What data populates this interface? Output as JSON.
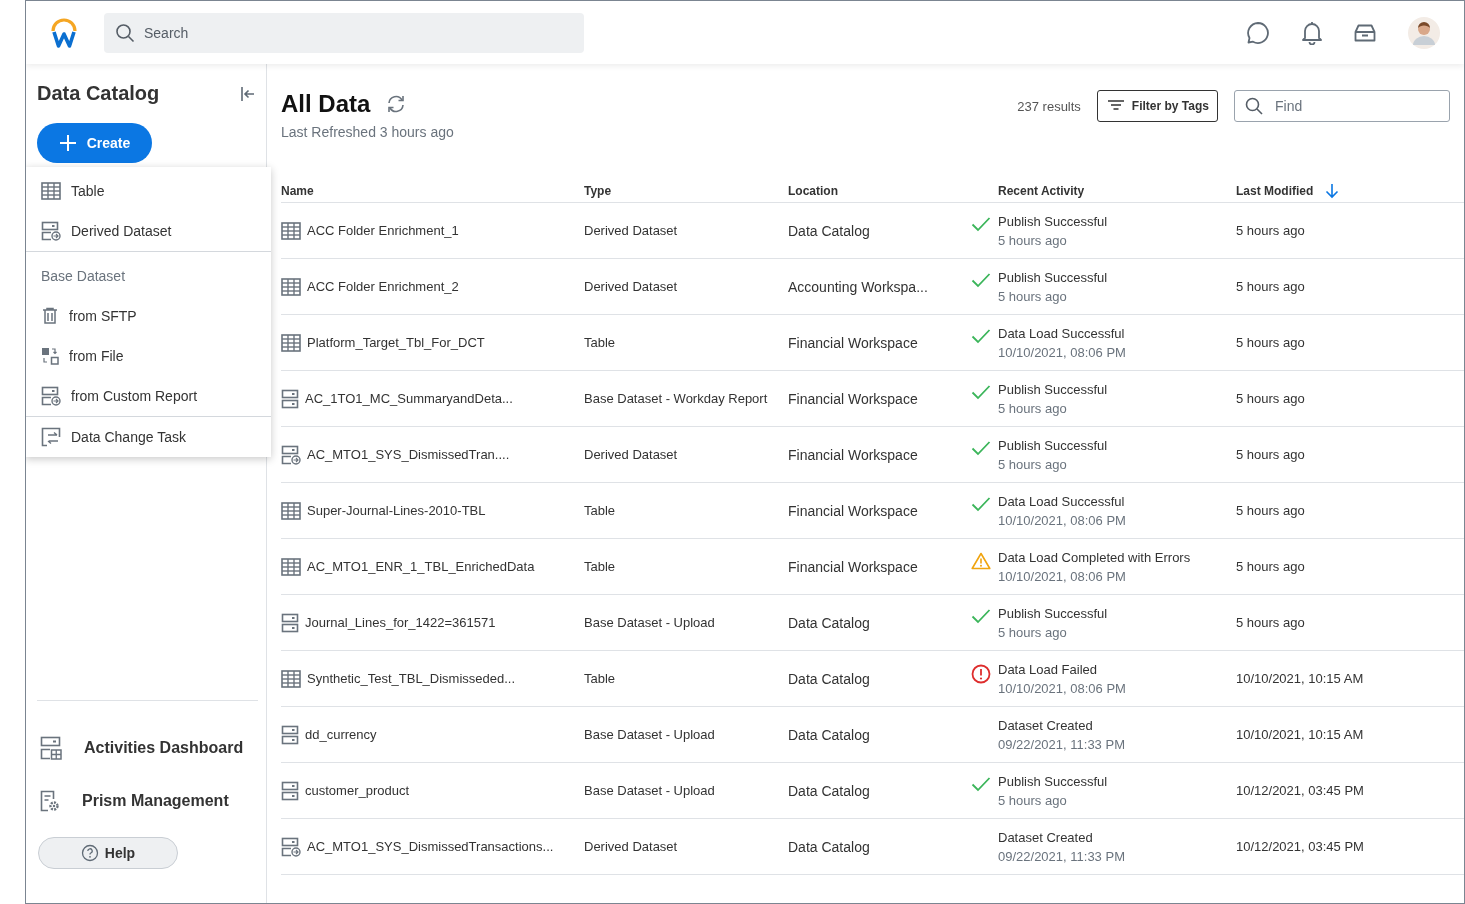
{
  "header": {
    "search": {
      "placeholder": "Search"
    }
  },
  "sidebar": {
    "title": "Data Catalog",
    "create_button": "Create",
    "create_menu": [
      {
        "items": [
          {
            "kind": "table",
            "label": "Table"
          },
          {
            "kind": "derived",
            "label": "Derived Dataset"
          }
        ]
      },
      {
        "heading": "Base Dataset",
        "items": [
          {
            "kind": "trash",
            "label": "from SFTP"
          },
          {
            "kind": "file",
            "label": "from File"
          },
          {
            "kind": "derived",
            "label": "from Custom Report"
          }
        ]
      },
      {
        "items": [
          {
            "kind": "task",
            "label": "Data Change Task"
          }
        ]
      }
    ],
    "nav": [
      {
        "kind": "dashboard",
        "label": "Activities Dashboard"
      },
      {
        "kind": "manage",
        "label": "Prism Management"
      }
    ],
    "help_button": "Help"
  },
  "main": {
    "title": "All Data",
    "subtitle": "Last Refreshed 3 hours ago",
    "results": "237 results",
    "filter_button": "Filter by Tags",
    "find": {
      "placeholder": "Find"
    },
    "table": {
      "columns": [
        "Name",
        "Type",
        "Location",
        "Recent Activity",
        "Last Modified"
      ],
      "rows": [
        {
          "kind": "table",
          "name": "ACC Folder Enrichment_1",
          "type": "Derived Dataset",
          "location": "Data Catalog",
          "activity": {
            "kind": "success",
            "text": "Publish Successful",
            "time": "5 hours ago"
          },
          "modified": "5 hours ago"
        },
        {
          "kind": "table",
          "name": "ACC Folder Enrichment_2",
          "type": "Derived Dataset",
          "location": "Accounting Workspa...",
          "activity": {
            "kind": "success",
            "text": "Publish Successful",
            "time": "5 hours ago"
          },
          "modified": "5 hours ago"
        },
        {
          "kind": "table",
          "name": "Platform_Target_Tbl_For_DCT",
          "type": "Table",
          "location": "Financial Workspace",
          "activity": {
            "kind": "success",
            "text": "Data Load Successful",
            "time": "10/10/2021, 08:06 PM"
          },
          "modified": "5 hours ago"
        },
        {
          "kind": "base",
          "name": "AC_1TO1_MC_SummaryandDeta...",
          "type": "Base Dataset - Workday Report",
          "location": "Financial Workspace",
          "activity": {
            "kind": "success",
            "text": "Publish Successful",
            "time": "5 hours ago"
          },
          "modified": "5 hours ago"
        },
        {
          "kind": "derived",
          "name": "AC_MTO1_SYS_DismissedTran....",
          "type": "Derived Dataset",
          "location": "Financial Workspace",
          "activity": {
            "kind": "success",
            "text": "Publish Successful",
            "time": "5 hours ago"
          },
          "modified": "5 hours ago"
        },
        {
          "kind": "table",
          "name": "Super-Journal-Lines-2010-TBL",
          "type": "Table",
          "location": "Financial Workspace",
          "activity": {
            "kind": "success",
            "text": "Data Load Successful",
            "time": "10/10/2021, 08:06 PM"
          },
          "modified": "5 hours ago"
        },
        {
          "kind": "table",
          "name": "AC_MTO1_ENR_1_TBL_EnrichedData",
          "type": "Table",
          "location": "Financial Workspace",
          "activity": {
            "kind": "warning",
            "text": "Data Load Completed with Errors",
            "time": "10/10/2021, 08:06 PM"
          },
          "modified": "5 hours ago"
        },
        {
          "kind": "base",
          "name": "Journal_Lines_for_1422=361571",
          "type": "Base Dataset - Upload",
          "location": "Data Catalog",
          "activity": {
            "kind": "success",
            "text": "Publish Successful",
            "time": "5 hours ago"
          },
          "modified": "5 hours ago"
        },
        {
          "kind": "table",
          "name": "Synthetic_Test_TBL_Dismisseded...",
          "type": "Table",
          "location": "Data Catalog",
          "activity": {
            "kind": "error",
            "text": "Data Load Failed",
            "time": "10/10/2021, 08:06 PM"
          },
          "modified": "10/10/2021, 10:15 AM"
        },
        {
          "kind": "base",
          "name": "dd_currency",
          "type": "Base Dataset - Upload",
          "location": "Data Catalog",
          "activity": {
            "kind": "plain",
            "text": "Dataset Created",
            "time": "09/22/2021, 11:33 PM"
          },
          "modified": "10/10/2021, 10:15 AM"
        },
        {
          "kind": "base",
          "name": "customer_product",
          "type": "Base Dataset - Upload",
          "location": "Data Catalog",
          "activity": {
            "kind": "success",
            "text": "Publish Successful",
            "time": "5 hours ago"
          },
          "modified": "10/12/2021, 03:45 PM"
        },
        {
          "kind": "derived",
          "name": "AC_MTO1_SYS_DismissedTransactions...",
          "type": "Derived Dataset",
          "location": "Data Catalog",
          "activity": {
            "kind": "plain",
            "text": "Dataset Created",
            "time": "09/22/2021, 11:33 PM"
          },
          "modified": "10/12/2021, 03:45 PM"
        }
      ]
    }
  }
}
